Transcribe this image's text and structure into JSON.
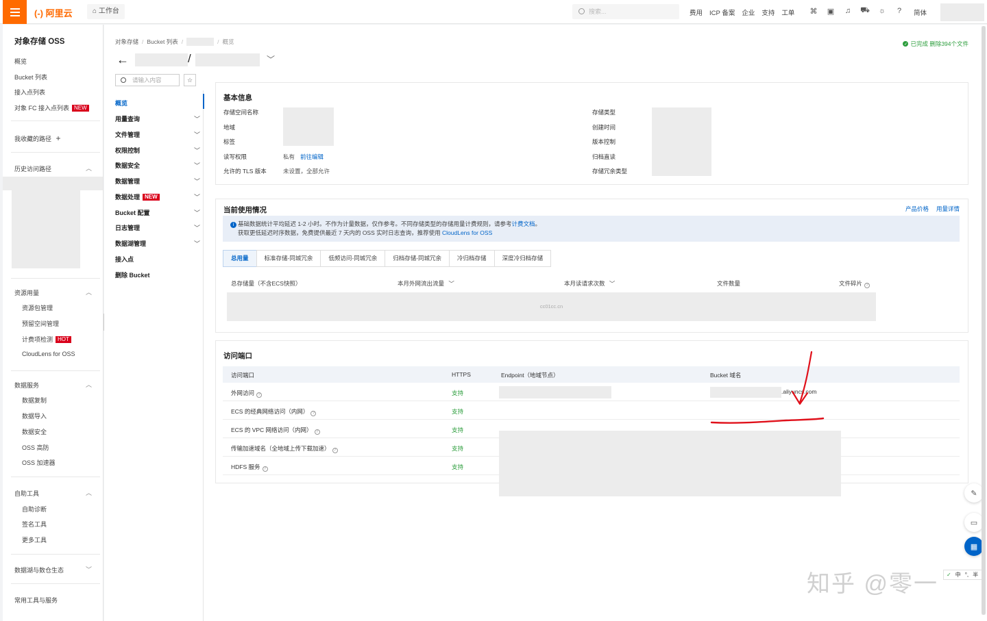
{
  "topbar": {
    "logo": "(-) 阿里云",
    "workbench": "工作台",
    "search_placeholder": "搜索...",
    "links": [
      "费用",
      "ICP 备案",
      "企业",
      "支持",
      "工单"
    ],
    "lang": "简体"
  },
  "sidebar": {
    "title": "对象存储 OSS",
    "items": [
      "概览",
      "Bucket 列表",
      "接入点列表",
      "对象 FC 接入点列表"
    ],
    "new_badge": "NEW",
    "hot_badge": "HOT",
    "favorites": "我收藏的路径",
    "history": "历史访问路径",
    "resource_group": "资源用量",
    "resource_items": [
      "资源包管理",
      "预留空间管理",
      "计费项检测",
      "CloudLens for OSS"
    ],
    "data_group": "数据服务",
    "data_items": [
      "数据复制",
      "数据导入",
      "数据安全",
      "OSS 高防",
      "OSS 加速器"
    ],
    "self_group": "自助工具",
    "self_items": [
      "自助诊断",
      "签名工具",
      "更多工具"
    ],
    "lake_group": "数据湖与数仓生态",
    "cut_item": "常用工具与服务"
  },
  "breadcrumb": [
    "对象存储",
    "Bucket 列表",
    "概览"
  ],
  "done_tag": "已完成 删除394个文件",
  "subnav": {
    "search_placeholder": "请输入内容",
    "items": [
      "概览",
      "用量查询",
      "文件管理",
      "权限控制",
      "数据安全",
      "数据管理",
      "数据处理",
      "Bucket 配置",
      "日志管理",
      "数据湖管理",
      "接入点",
      "删除 Bucket"
    ]
  },
  "basic": {
    "title": "基本信息",
    "left_labels": [
      "存储空间名称",
      "地域",
      "标签",
      "读写权限",
      "允许的 TLS 版本"
    ],
    "acl_value": "私有",
    "acl_link": "前往编辑",
    "tls_value": "未设置，全部允许",
    "right_labels": [
      "存储类型",
      "创建时间",
      "版本控制",
      "归档直读",
      "存储冗余类型"
    ]
  },
  "usage": {
    "title": "当前使用情况",
    "link_price": "产品价格",
    "link_detail": "用量详情",
    "notice_line1_a": "基础数据统计平均延迟 1-2 小时。不作为计量数据，仅作参考。不同存储类型的存储用量计费规则，请参考",
    "notice_line1_link": "计费文档",
    "notice_line1_b": "。",
    "notice_line2_a": "获取更低延迟时序数据，免费提供最近 7 天内的 OSS 实时日志查询，推荐使用",
    "notice_line2_link": "CloudLens for OSS",
    "tabs": [
      "总用量",
      "标准存储-同城冗余",
      "低频访问-同城冗余",
      "归档存储-同城冗余",
      "冷归档存储",
      "深度冷归档存储"
    ],
    "headers": [
      "总存储量（不含ECS快照）",
      "本月外网流出流量",
      "本月读请求次数",
      "文件数量",
      "文件碎片"
    ],
    "blank_text": "cc01cc.cn"
  },
  "endpoints": {
    "title": "访问端口",
    "headers": [
      "访问端口",
      "HTTPS",
      "Endpoint（地域节点）",
      "Bucket 域名"
    ],
    "rows": [
      {
        "name": "外网访问",
        "https": "支持"
      },
      {
        "name": "ECS 的经典网络访问（内网）",
        "https": "支持"
      },
      {
        "name": "ECS 的 VPC 网络访问（内网）",
        "https": "支持"
      },
      {
        "name": "传输加速域名（全地域上传下载加速）",
        "https": "支持"
      },
      {
        "name": "HDFS 服务",
        "https": "支持"
      }
    ],
    "domain_suffix": ".aliyuncs.com"
  },
  "watermark": "知乎 @零一",
  "ime": [
    "中",
    "半"
  ],
  "colors": {
    "accent": "#ff6a00",
    "link": "#0064c8",
    "success": "#2e9e3e",
    "badge": "#d9001b",
    "annotation": "#e0101a"
  }
}
